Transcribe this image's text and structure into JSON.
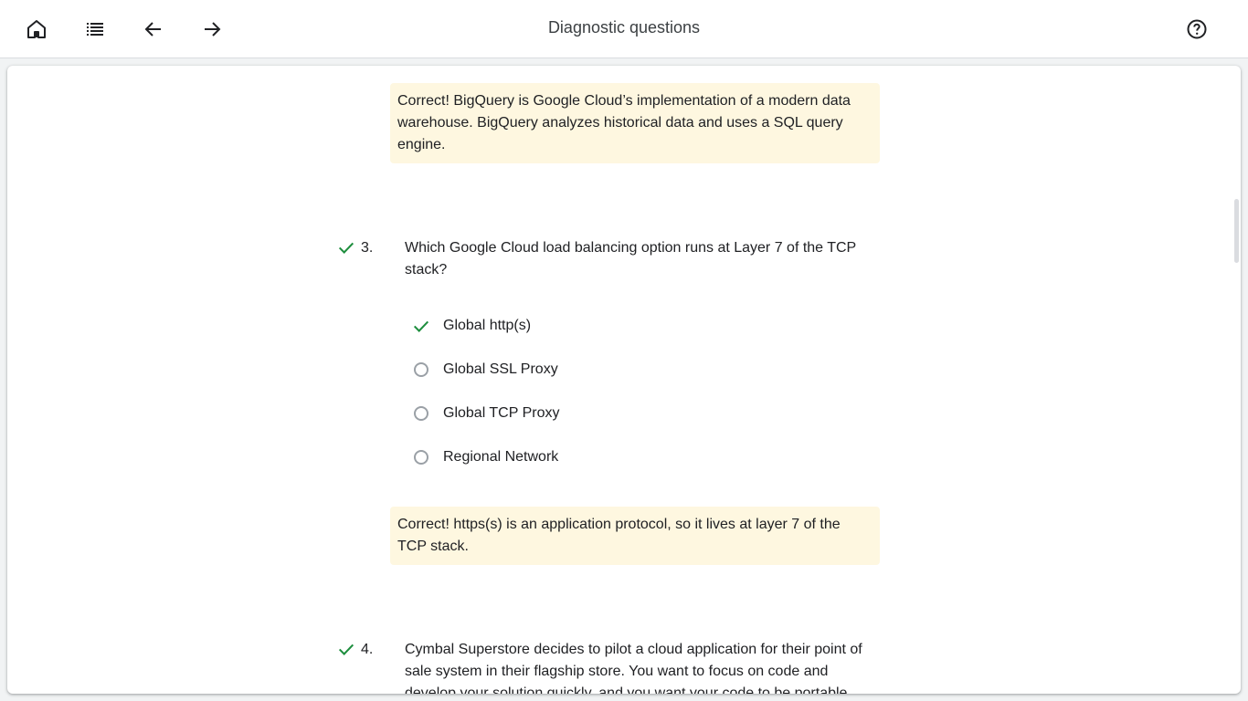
{
  "header": {
    "title": "Diagnostic questions",
    "nav": [
      {
        "name": "home-icon"
      },
      {
        "name": "list-icon"
      },
      {
        "name": "arrow-back-icon"
      },
      {
        "name": "arrow-forward-icon"
      }
    ],
    "help_icon": "help-icon"
  },
  "colors": {
    "correct_green": "#1e8e3e",
    "feedback_bg": "#fef7e0"
  },
  "feedback_prev": "Correct! BigQuery is Google Cloud’s implementation of a modern data warehouse. BigQuery analyzes historical data and uses a SQL query engine.",
  "questions": [
    {
      "number": "3.",
      "text": "Which Google Cloud load balancing option runs at Layer 7 of the TCP stack?",
      "options": [
        {
          "label": "Global http(s)",
          "state": "correct"
        },
        {
          "label": "Global SSL Proxy",
          "state": "unselected"
        },
        {
          "label": "Global TCP Proxy",
          "state": "unselected"
        },
        {
          "label": "Regional Network",
          "state": "unselected"
        }
      ],
      "feedback": "Correct! https(s) is an application protocol, so it lives at layer 7 of the TCP stack."
    },
    {
      "number": "4.",
      "text": "Cymbal Superstore decides to pilot a cloud application for their point of sale system in their flagship store. You want to focus on code and develop your solution quickly, and you want your code to be portable."
    }
  ]
}
